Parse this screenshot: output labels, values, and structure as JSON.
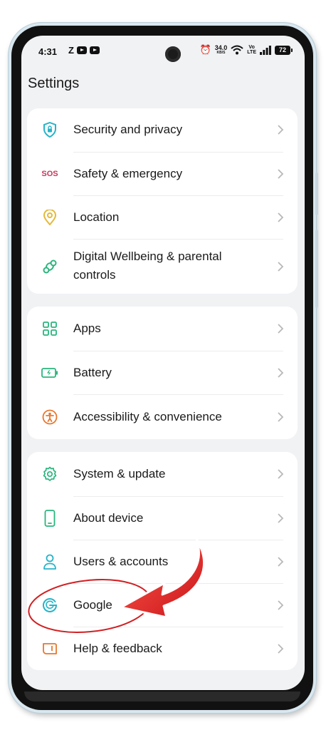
{
  "status_bar": {
    "time": "4:31",
    "notif_letter": "Z",
    "speed_value": "34.0",
    "speed_unit": "KB/S",
    "volte_top": "Vo",
    "volte_bottom": "LTE",
    "battery": "72"
  },
  "header": {
    "title": "Settings"
  },
  "groups": [
    {
      "items": [
        {
          "label": "Security and privacy",
          "icon": "shield-lock-icon",
          "color": "#27b3c7"
        },
        {
          "label": "Safety & emergency",
          "icon": "sos-icon",
          "icon_text": "SOS",
          "color": "#c9355b"
        },
        {
          "label": "Location",
          "icon": "location-pin-icon",
          "color": "#e4b93a"
        },
        {
          "label": "Digital Wellbeing & parental",
          "label2": "controls",
          "icon": "wellbeing-icon",
          "color": "#2ab57d"
        }
      ]
    },
    {
      "items": [
        {
          "label": "Apps",
          "icon": "apps-grid-icon",
          "color": "#2ab57d"
        },
        {
          "label": "Battery",
          "icon": "battery-icon",
          "color": "#2ab57d"
        },
        {
          "label": "Accessibility & convenience",
          "icon": "accessibility-icon",
          "color": "#e8772e"
        }
      ]
    },
    {
      "items": [
        {
          "label": "System & update",
          "icon": "gear-icon",
          "color": "#2ab57d"
        },
        {
          "label": "About device",
          "icon": "phone-icon",
          "color": "#2ab57d"
        },
        {
          "label": "Users & accounts",
          "icon": "user-icon",
          "color": "#27b3c7"
        },
        {
          "label": "Google",
          "icon": "google-icon",
          "color": "#27b3c7"
        },
        {
          "label": "Help & feedback",
          "icon": "help-book-icon",
          "color": "#e8772e"
        }
      ]
    }
  ],
  "annotation": {
    "arrow_color": "#e3262a",
    "circle_color": "#e3262a",
    "target": "Google"
  }
}
